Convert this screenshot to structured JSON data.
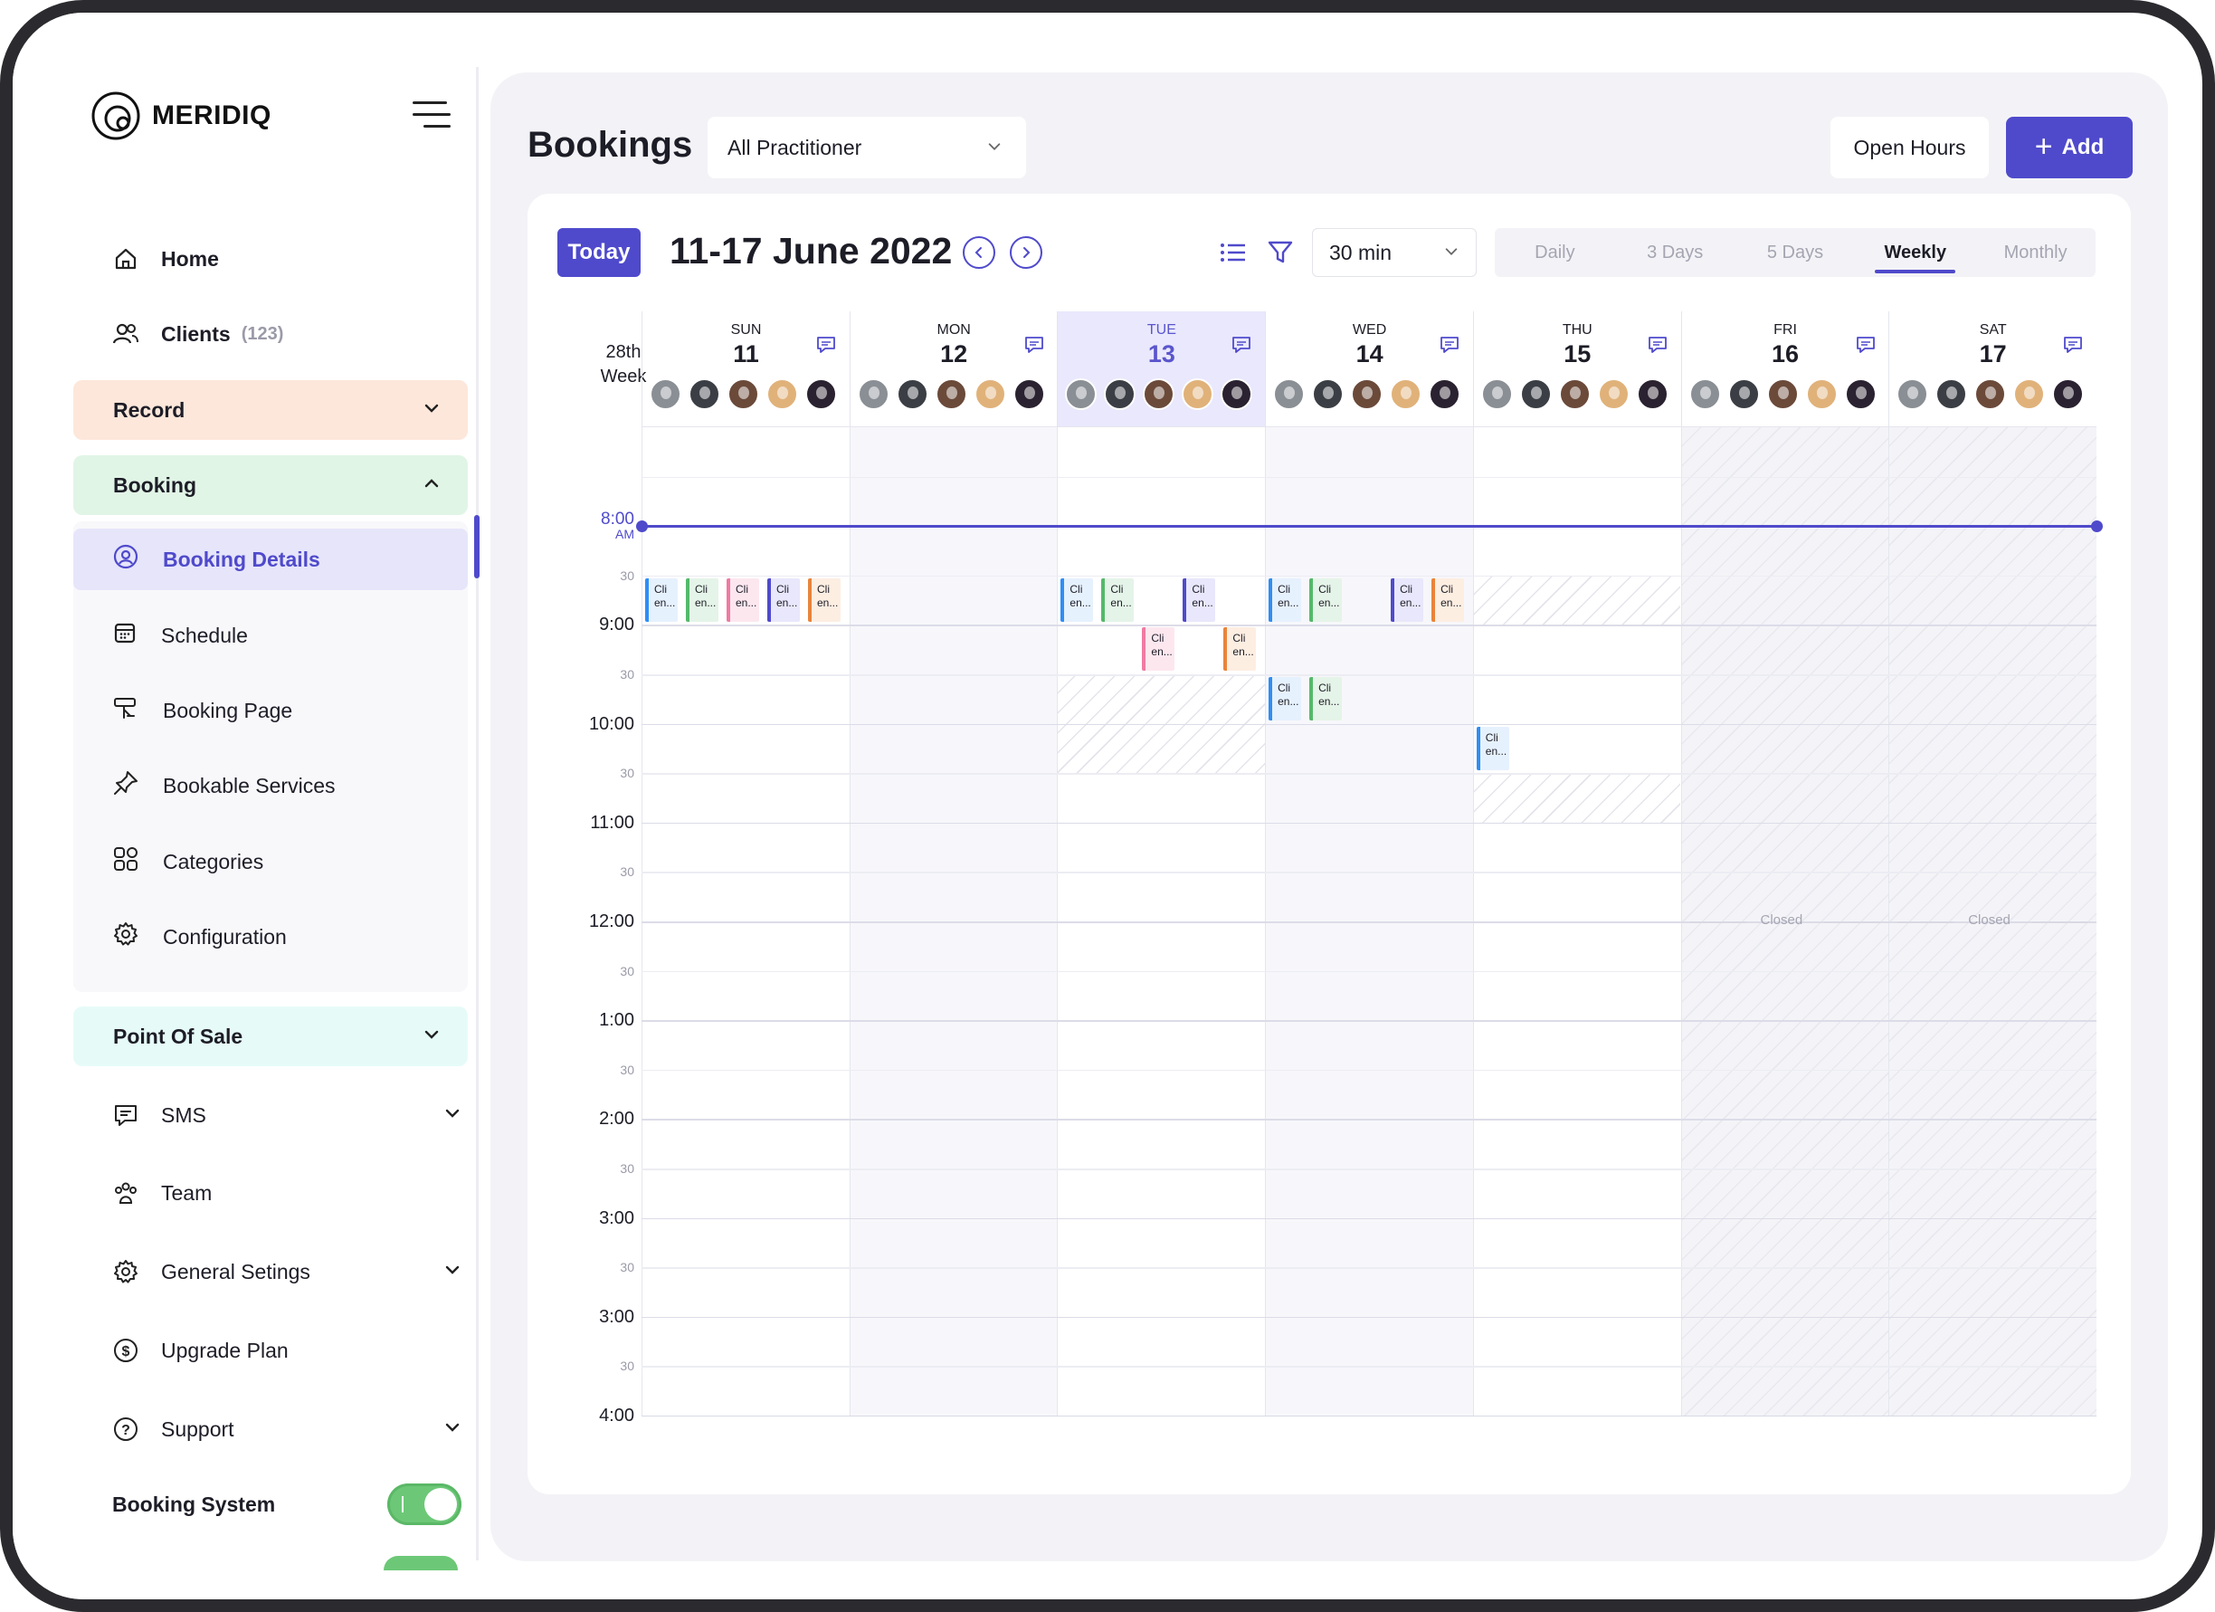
{
  "app": {
    "name": "MERIDIQ"
  },
  "sidebar": {
    "home": "Home",
    "clients": "Clients",
    "clients_count": "(123)",
    "record": "Record",
    "booking": "Booking",
    "booking_items": [
      "Booking Details",
      "Schedule",
      "Booking Page",
      "Bookable Services",
      "Categories",
      "Configuration"
    ],
    "point_of_sale": "Point Of Sale",
    "sms": "SMS",
    "team": "Team",
    "general_settings": "General Setings",
    "upgrade_plan": "Upgrade Plan",
    "support": "Support",
    "booking_system": "Booking System",
    "booking_system_on": true
  },
  "header": {
    "title": "Bookings",
    "practitioner": "All Practitioner",
    "open_hours": "Open Hours",
    "add": "Add"
  },
  "toolbar": {
    "today": "Today",
    "range": "11-17 June 2022",
    "interval": "30 min",
    "views": [
      "Daily",
      "3 Days",
      "5 Days",
      "Weekly",
      "Monthly"
    ],
    "active_view": "Weekly"
  },
  "calendar": {
    "week_label": [
      "28th",
      "Week"
    ],
    "days": [
      {
        "name": "SUN",
        "num": "11"
      },
      {
        "name": "MON",
        "num": "12"
      },
      {
        "name": "TUE",
        "num": "13"
      },
      {
        "name": "WED",
        "num": "14"
      },
      {
        "name": "THU",
        "num": "15"
      },
      {
        "name": "FRI",
        "num": "16"
      },
      {
        "name": "SAT",
        "num": "17"
      }
    ],
    "today_index": 2,
    "now_label": [
      "8:00",
      "AM"
    ],
    "time_labels": [
      "8:00",
      "30",
      "9:00",
      "30",
      "10:00",
      "30",
      "11:00",
      "30",
      "12:00",
      "30",
      "1:00",
      "30",
      "2:00",
      "30",
      "3:00",
      "30",
      "3:00",
      "30",
      "4:00"
    ],
    "closed_label": "Closed",
    "event_text": [
      "Cli",
      "en..."
    ],
    "event_colors": {
      "blue": "#2f8ef5",
      "green": "#55b96b",
      "pink": "#f07aa3",
      "indigo": "#4f4acb",
      "orange": "#e9843b"
    },
    "avatar_colors": [
      "#8a8f95",
      "#3b3f45",
      "#6b4a3a",
      "#e0b27a",
      "#2a2230"
    ]
  },
  "colors": {
    "accent": "#4f4acb",
    "record_bg": "#fde7da",
    "booking_bg": "#e1f5e6",
    "pos_bg": "#e6fbf8",
    "toggle": "#6cc877"
  }
}
